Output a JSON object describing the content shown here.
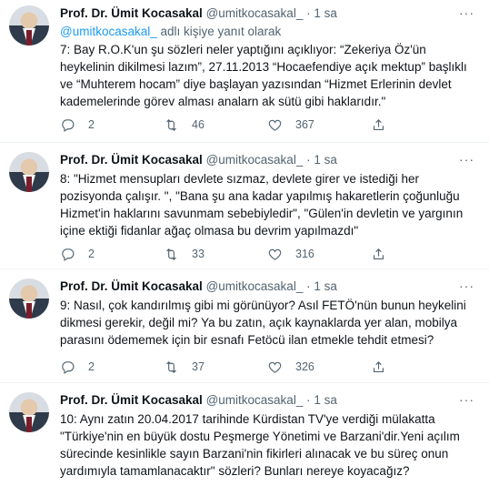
{
  "tweets": [
    {
      "name": "Prof. Dr. Ümit Kocasakal",
      "handle": "@umitkocasakal_",
      "dot": "·",
      "time": "1 sa",
      "reply_mention": "@umitkocasakal_",
      "reply_suffix": " adlı kişiye yanıt olarak",
      "lines": [
        "7: Bay R.O.K'un şu sözleri neler yaptığını açıklıyor:  “Zekeriya Öz'ün",
        "heykelinin dikilmesi lazım”, 27.11.2013 “Hocaefendiye açık mektup” başlıklı",
        "ve “Muhterem hocam” diye başlayan yazısından  “Hizmet Erlerinin devlet",
        "kademelerinde görev alması analarn ak sütü gibi haklarıdır.\""
      ],
      "replies": "2",
      "retweets": "46",
      "likes": "367"
    },
    {
      "name": "Prof. Dr. Ümit Kocasakal",
      "handle": "@umitkocasakal_",
      "dot": "·",
      "time": "1 sa",
      "lines": [
        "8:  \"Hizmet mensupları devlete sızmaz, devlete girer ve istediği her",
        "pozisyonda çalışır. \",  \"Bana şu ana kadar yapılmış hakaretlerin çoğunluğu",
        "Hizmet'in haklarını savunmam sebebiyledir\", \"Gülen'in devletin ve yargının",
        "içine ektiği fidanlar ağaç olmasa bu devrim yapılmazdı\""
      ],
      "replies": "2",
      "retweets": "33",
      "likes": "316"
    },
    {
      "name": "Prof. Dr. Ümit Kocasakal",
      "handle": "@umitkocasakal_",
      "dot": "·",
      "time": "1 sa",
      "lines": [
        "9: Nasıl, çok kandırılmış gibi mi görünüyor? Asıl FETÖ'nün bunun heykelini",
        "dikmesi gerekir, değil mi? Ya bu zatın, açık kaynaklarda yer alan, mobilya",
        "parasını ödememek için bir esnafı Fetöcü ilan etmekle tehdit etmesi?"
      ],
      "replies": "2",
      "retweets": "37",
      "likes": "326"
    },
    {
      "name": "Prof. Dr. Ümit Kocasakal",
      "handle": "@umitkocasakal_",
      "dot": "·",
      "time": "1 sa",
      "lines": [
        "10: Aynı zatın 20.04.2017 tarihinde Kürdistan TV'ye verdiği mülakatta",
        "\"Türkiye'nin en büyük dostu Peşmerge Yönetimi ve Barzani'dir.Yeni açılım",
        "sürecinde kesinlikle sayın Barzani'nin fikirleri alınacak ve bu süreç onun",
        "yardımıyla tamamlanacaktır\" sözleri? Bunları nereye koyacağız?"
      ]
    }
  ],
  "icons": {
    "reply": "reply-icon",
    "retweet": "retweet-icon",
    "like": "heart-icon",
    "share": "share-icon",
    "more": "more-icon"
  },
  "colors": {
    "accent": "#1d9bf0",
    "secondary_text": "#536471",
    "divider": "#eff3f4"
  }
}
